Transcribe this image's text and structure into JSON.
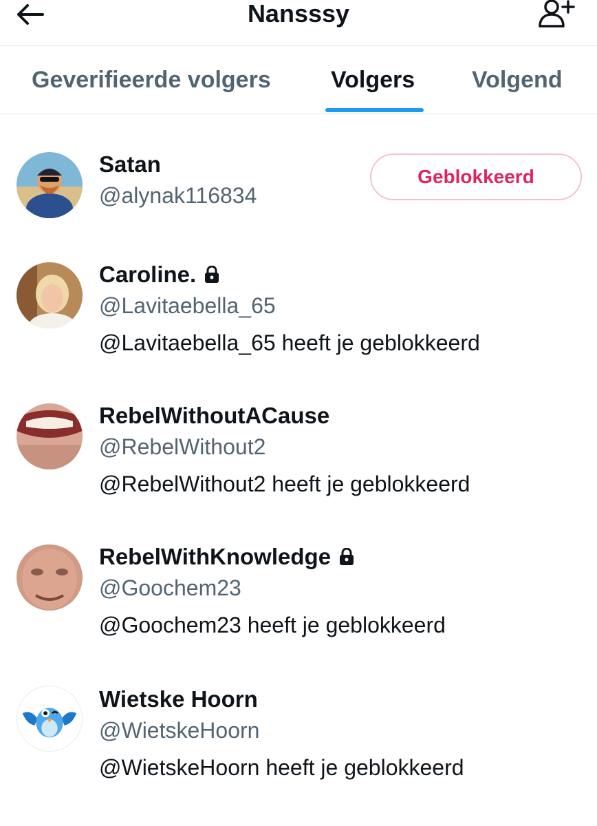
{
  "header": {
    "title": "Nansssy",
    "back_icon": "arrow-left-icon",
    "add_icon": "add-person-icon"
  },
  "tabs": [
    {
      "label": "Geverifieerde volgers",
      "active": false
    },
    {
      "label": "Volgers",
      "active": true
    },
    {
      "label": "Volgend",
      "active": false
    }
  ],
  "colors": {
    "accent": "#1d9bf0",
    "blocked_text": "#e0245e",
    "blocked_border": "#f4c3c9",
    "secondary_text": "#536471"
  },
  "followers": [
    {
      "name": "Satan",
      "handle": "@alynak116834",
      "locked": false,
      "button_label": "Geblokkeerd"
    },
    {
      "name": "Caroline.",
      "handle": "@Lavitaebella_65",
      "locked": true,
      "note": "@Lavitaebella_65 heeft je geblokkeerd"
    },
    {
      "name": "RebelWithoutACause",
      "handle": "@RebelWithout2",
      "locked": false,
      "note": "@RebelWithout2 heeft je geblokkeerd"
    },
    {
      "name": "RebelWithKnowledge",
      "handle": "@Goochem23",
      "locked": true,
      "note": "@Goochem23 heeft je geblokkeerd"
    },
    {
      "name": "Wietske Hoorn",
      "handle": "@WietskeHoorn",
      "locked": false,
      "note": "@WietskeHoorn heeft je geblokkeerd"
    }
  ]
}
